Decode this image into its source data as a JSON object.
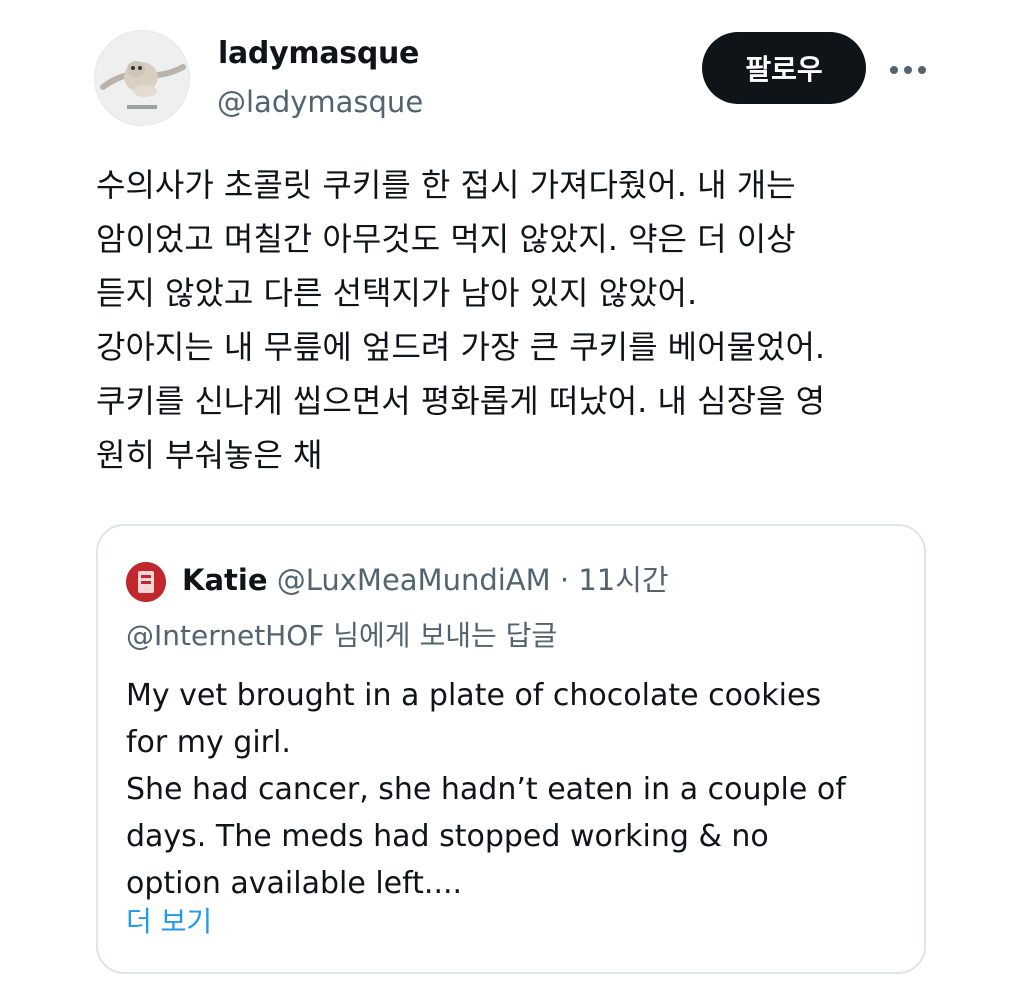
{
  "author": {
    "name": "ladymasque",
    "handle": "@ladymasque",
    "avatar_icon": "flying-squirrel-avatar"
  },
  "actions": {
    "follow_label": "팔로우",
    "more_icon": "more-dots-icon"
  },
  "tweet": {
    "lines": [
      "수의사가 초콜릿 쿠키를 한 접시 가져다줬어. 내 개는",
      "암이었고 며칠간 아무것도 먹지 않았지. 약은 더 이상",
      "듣지 않았고 다른 선택지가 남아 있지 않았어.",
      "강아지는 내 무릎에 엎드려 가장 큰 쿠키를 베어물었어.",
      "쿠키를 신나게 씹으면서 평화롭게 떠났어. 내 심장을 영",
      "원히 부숴놓은 채"
    ]
  },
  "quote": {
    "name": "Katie",
    "handle": "@LuxMeaMundiAM",
    "separator": "·",
    "time": "11시간",
    "reply_to": "@InternetHOF 님에게 보내는 답글",
    "lines": [
      "My vet brought in a plate of chocolate cookies",
      "for my girl.",
      "She had cancer, she hadn’t eaten in a couple of",
      "days. The meds had stopped working & no",
      "option available left...."
    ],
    "show_more": "더 보기",
    "avatar_icon": "red-avatar-icon"
  },
  "colors": {
    "text": "#0f1419",
    "secondary": "#536471",
    "link": "#1d9bf0",
    "border": "#dfe4e8",
    "button_bg": "#0f1419"
  }
}
